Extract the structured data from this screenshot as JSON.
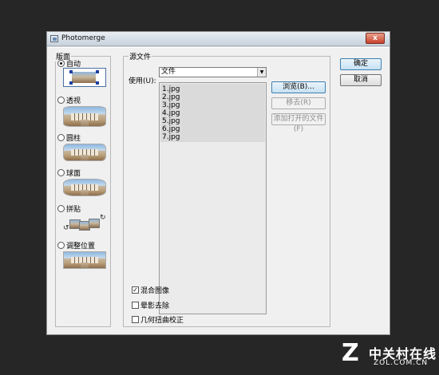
{
  "window": {
    "title": "Photomerge",
    "close_glyph": "x"
  },
  "layout_panel": {
    "group_label": "版面",
    "options": [
      {
        "label": "自动",
        "selected": true,
        "thumb_icon": "auto-layout-icon"
      },
      {
        "label": "透视",
        "selected": false,
        "thumb_icon": "perspective-icon"
      },
      {
        "label": "圆柱",
        "selected": false,
        "thumb_icon": "cylindrical-icon"
      },
      {
        "label": "球面",
        "selected": false,
        "thumb_icon": "spherical-icon"
      },
      {
        "label": "拼贴",
        "selected": false,
        "thumb_icon": "collage-icon"
      },
      {
        "label": "调整位置",
        "selected": false,
        "thumb_icon": "reposition-icon"
      }
    ]
  },
  "source_panel": {
    "group_label": "源文件",
    "use_label": "使用(U):",
    "use_value": "文件",
    "files": [
      "1.jpg",
      "2.jpg",
      "3.jpg",
      "4.jpg",
      "5.jpg",
      "6.jpg",
      "7.jpg"
    ],
    "browse_label": "浏览(B)...",
    "remove_label": "移去(R)",
    "add_open_label": "添加打开的文件(F)"
  },
  "options": {
    "blend_label": "混合图像",
    "blend_checked": true,
    "vignette_label": "晕影去除",
    "vignette_checked": false,
    "distortion_label": "几何扭曲校正",
    "distortion_checked": false
  },
  "actions": {
    "ok_label": "确定",
    "cancel_label": "取消"
  },
  "watermark": {
    "logo": "Z",
    "cn": "中关村在线",
    "en": "ZOL.COM.CN"
  },
  "colors": {
    "desktop": "#262626",
    "dialog": "#f0f0f0",
    "titlebar": "#c7d2dc",
    "close": "#c8432b"
  }
}
